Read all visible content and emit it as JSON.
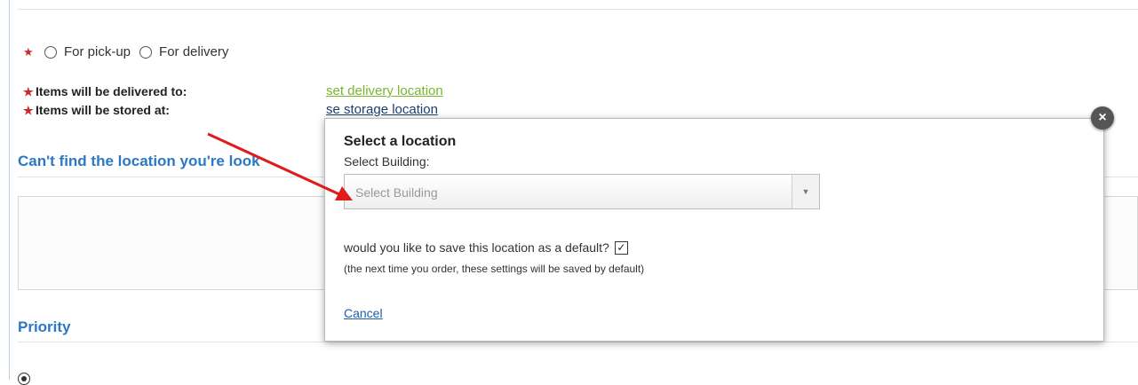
{
  "delivery_mode": {
    "options": [
      "For pick-up",
      "For delivery"
    ]
  },
  "locations": {
    "delivered_label": "Items will be delivered to:",
    "delivered_link": "set delivery location",
    "stored_label": "Items will be stored at:",
    "stored_link": "se storage location"
  },
  "sections": {
    "cant_find": "Can't find the location you're look",
    "priority": "Priority"
  },
  "modal": {
    "title": "Select a location",
    "select_label": "Select Building:",
    "select_placeholder": "Select Building",
    "save_default_text": "would you like to save this location as a default?",
    "save_default_checked": true,
    "save_note": "(the next time you order, these settings will be saved by default)",
    "cancel_label": "Cancel",
    "close_glyph": "×"
  },
  "annotation": {
    "arrow_color": "#e01b1b"
  },
  "colors": {
    "section_heading": "#2b78c5",
    "required_star": "#cc2a2a",
    "delivery_link": "#7ab52c"
  }
}
